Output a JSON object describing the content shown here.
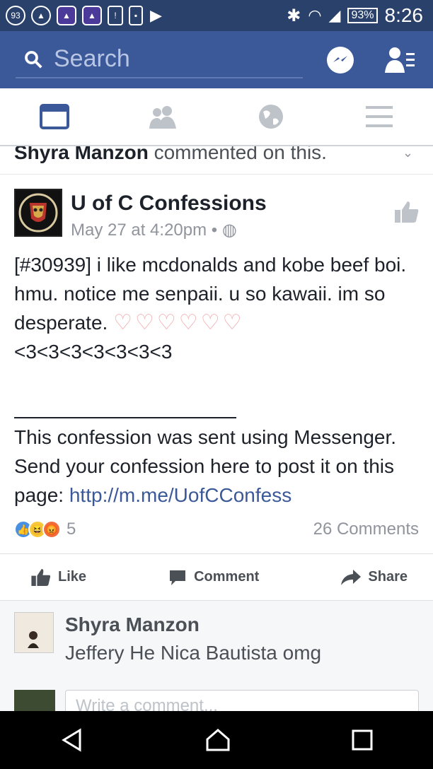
{
  "status_bar": {
    "badge": "93",
    "battery": "93%",
    "time": "8:26"
  },
  "top_bar": {
    "search_placeholder": "Search"
  },
  "notification": {
    "name": "Shyra Manzon",
    "text": "commented on this."
  },
  "post": {
    "page_name": "U of C Confessions",
    "timestamp": "May 27 at 4:20pm",
    "line1": "[#30939] i like mcdonalds and kobe beef boi. hmu. notice me senpaii. u so kawaii. im so desperate.",
    "hearts": "♡♡♡♡♡♡",
    "line2": "<3<3<3<3<3<3<3",
    "note": " This confession was sent using Messenger. Send your confession here to post it on this page:",
    "link": "http://m.me/UofCConfess",
    "reaction_count": "5",
    "comment_count": "26 Comments"
  },
  "actions": {
    "like": "Like",
    "comment": "Comment",
    "share": "Share"
  },
  "comment": {
    "name": "Shyra Manzon",
    "body": "Jeffery He Nica Bautista omg"
  },
  "composer": {
    "placeholder": "Write a comment..."
  },
  "colors": {
    "brand": "#3b5998",
    "status_bar": "#29416b"
  }
}
